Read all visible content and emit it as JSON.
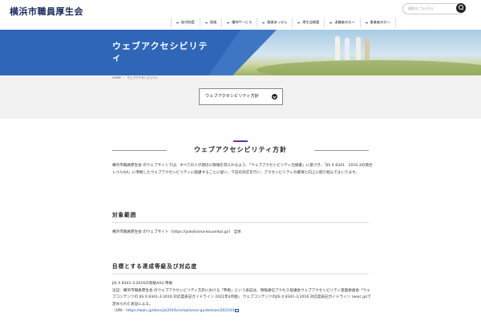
{
  "header": {
    "logo": "横浜市職員厚生会",
    "search_placeholder": "検索はこちらから",
    "nav": [
      "給付制度",
      "保険",
      "優待サービス",
      "融資あっせん",
      "厚生会概要",
      "退職者の方へ",
      "事業者の方へ"
    ]
  },
  "hero": {
    "title": "ウェブアクセシビリティ"
  },
  "breadcrumb": {
    "home": "HOME",
    "separator": "›",
    "current": "ウェブアクセシビリティ"
  },
  "anchor_button": {
    "label": "ウェブアクセシビリティ方針"
  },
  "section": {
    "title": "ウェブアクセシビリティ方針",
    "intro": "横浜市職員厚生会 のウェブサイトでは、すべての人が適切に情報を得られるよう、「ウェブアクセシビリティ仕様書」に基づき、「JIS X 8341　2016:3の適合レベルAA」に準拠したウェブアクセシビリティに配慮することに従い、下記の対応を行い、アクセシビリティの確保と向上に取り組んでまいります。",
    "scope_title": "対象範囲",
    "scope_text": "横浜市職員厚生会 のウェブサイト（https://yokohama-kouseikai.jp/） 全体",
    "target_title": "目標とする達成等級及び対応度",
    "target_text_1": "JIS X 8341-3:2016の等級AAに準拠",
    "target_text_2": "注記：横浜市職員厚生会 のウェブアクセシビリティ方針における「準拠」という表記は、情報通信アクセス協議会ウェブアクセシビリティ基盤委員会「ウェブコンテンツの JIS X 8341-3:2016 対応度表記ガイドライン 2021年4月版」 ウェブコンテンツのJIS X 8341-3:2016 対応度表記ガイドライン (waic.jp)で定められた表記による。",
    "target_link_prefix": "（URI：",
    "target_link": "https://waic.jp/docs/jis2016/compliance-guidelines/202104"
  }
}
